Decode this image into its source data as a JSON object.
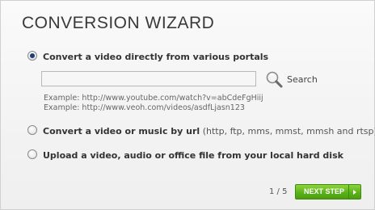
{
  "wizard": {
    "title": "CONVERSION WIZARD"
  },
  "options": [
    {
      "label": "Convert a video directly from various portals",
      "suffix": "",
      "selected": true
    },
    {
      "label": "Convert a video or music by url",
      "suffix": " (http, ftp, mms, mmst, mmsh and rtsp)",
      "selected": false
    },
    {
      "label": "Upload a video, audio or office file from your local hard disk",
      "suffix": "",
      "selected": false
    }
  ],
  "search": {
    "input_value": "",
    "placeholder": "",
    "button_label": "Search",
    "icon": "magnifier-icon"
  },
  "examples": [
    "Example: http://www.youtube.com/watch?v=abCdeFgHiij",
    "Example: http://www.veoh.com/videos/asdfLjasn123"
  ],
  "footer": {
    "pager": "1 / 5",
    "next_label": "NEXT STEP",
    "next_color": "#5cb21a"
  }
}
